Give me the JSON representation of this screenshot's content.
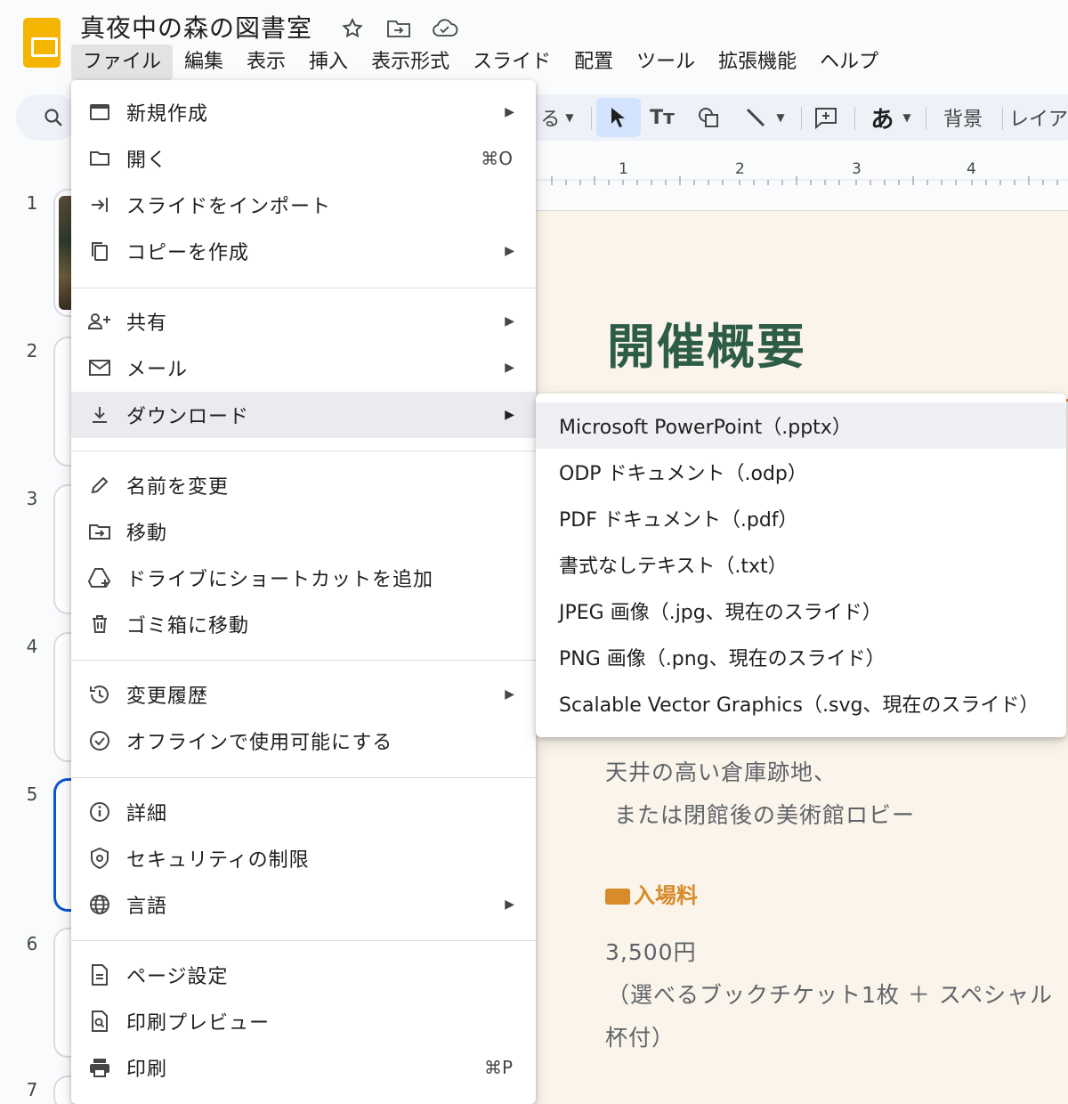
{
  "app": {
    "title": "真夜中の森の図書室"
  },
  "menubar": {
    "items": [
      {
        "label": "ファイル"
      },
      {
        "label": "編集"
      },
      {
        "label": "表示"
      },
      {
        "label": "挿入"
      },
      {
        "label": "表示形式"
      },
      {
        "label": "スライド"
      },
      {
        "label": "配置"
      },
      {
        "label": "ツール"
      },
      {
        "label": "拡張機能"
      },
      {
        "label": "ヘルプ"
      }
    ]
  },
  "toolbar": {
    "partial_label": "る",
    "text_style_label": "Tт",
    "ime_label": "あ",
    "background_label": "背景",
    "layout_label": "レイア"
  },
  "ruler": {
    "ticks": [
      "1",
      "2",
      "3",
      "4"
    ]
  },
  "filmstrip": {
    "numbers": [
      "1",
      "2",
      "3",
      "4",
      "5",
      "6",
      "7"
    ],
    "selected": "5"
  },
  "file_menu": {
    "items": [
      {
        "label": "新規作成",
        "icon": "new-slide-icon",
        "submenu": true
      },
      {
        "label": "開く",
        "icon": "folder-icon",
        "shortcut": "⌘O"
      },
      {
        "label": "スライドをインポート",
        "icon": "import-icon"
      },
      {
        "label": "コピーを作成",
        "icon": "copy-icon",
        "submenu": true
      },
      {
        "label": "共有",
        "icon": "share-icon",
        "submenu": true
      },
      {
        "label": "メール",
        "icon": "mail-icon",
        "submenu": true
      },
      {
        "label": "ダウンロード",
        "icon": "download-icon",
        "submenu": true,
        "hover": true
      },
      {
        "label": "名前を変更",
        "icon": "pencil-icon"
      },
      {
        "label": "移動",
        "icon": "move-folder-icon"
      },
      {
        "label": "ドライブにショートカットを追加",
        "icon": "drive-shortcut-icon"
      },
      {
        "label": "ゴミ箱に移動",
        "icon": "trash-icon"
      },
      {
        "label": "変更履歴",
        "icon": "history-icon",
        "submenu": true
      },
      {
        "label": "オフラインで使用可能にする",
        "icon": "offline-icon"
      },
      {
        "label": "詳細",
        "icon": "info-icon"
      },
      {
        "label": "セキュリティの制限",
        "icon": "security-icon"
      },
      {
        "label": "言語",
        "icon": "globe-icon",
        "submenu": true
      },
      {
        "label": "ページ設定",
        "icon": "page-setup-icon"
      },
      {
        "label": "印刷プレビュー",
        "icon": "print-preview-icon"
      },
      {
        "label": "印刷",
        "icon": "print-icon",
        "shortcut": "⌘P"
      }
    ]
  },
  "download_menu": {
    "items": [
      {
        "label": "Microsoft PowerPoint（.pptx）"
      },
      {
        "label": "ODP ドキュメント（.odp）"
      },
      {
        "label": "PDF ドキュメント（.pdf）"
      },
      {
        "label": "書式なしテキスト（.txt）"
      },
      {
        "label": "JPEG 画像（.jpg、現在のスライド）"
      },
      {
        "label": "PNG 画像（.png、現在のスライド）"
      },
      {
        "label": "Scalable Vector Graphics（.svg、現在のスライド）"
      }
    ]
  },
  "slide": {
    "heading": "開催概要",
    "venue_line1": "天井の高い倉庫跡地、",
    "venue_line2": "または閉館後の美術館ロビー",
    "fee_heading": "入場料",
    "fee_price": "3,500円",
    "fee_detail1": "（選べるブックチケット1枚 ＋ スペシャル",
    "fee_detail2": "杯付）"
  },
  "colors": {
    "accent_blue": "#0b57d0",
    "slide_heading": "#2d5c47",
    "slide_accent": "#d88b2a"
  }
}
